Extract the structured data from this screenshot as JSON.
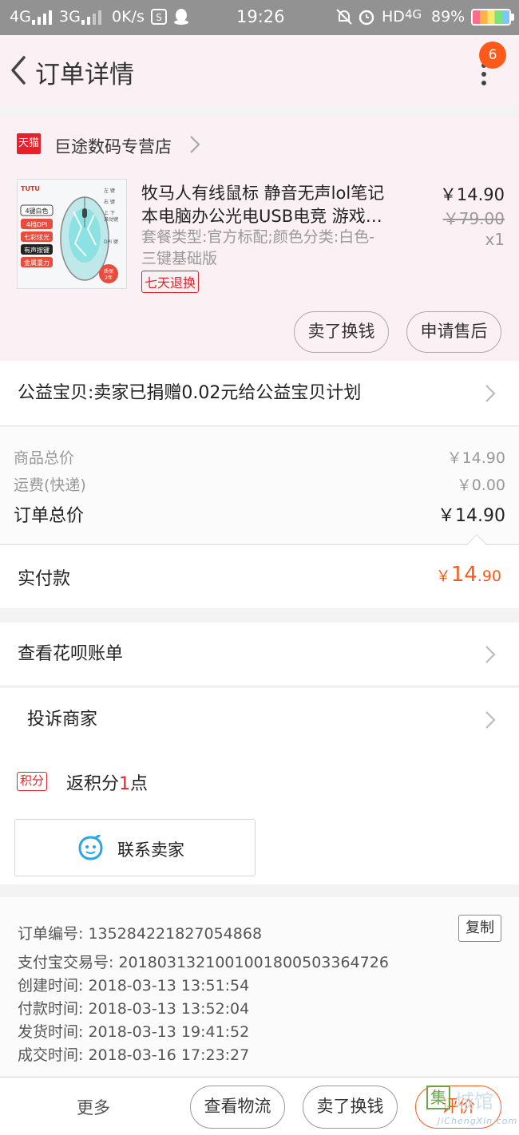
{
  "status_bar": {
    "network_1": "4G",
    "network_2": "3G",
    "speed": "0K/s",
    "time": "19:26",
    "hd_label": "HD",
    "hd_network": "4G",
    "battery": "89%"
  },
  "header": {
    "title": "订单详情",
    "notification_count": "6"
  },
  "shop": {
    "platform_badge": "天猫",
    "name": "巨途数码专营店"
  },
  "product": {
    "title": "牧马人有线鼠标 静音无声lol笔记本电脑办公光电USB电竞 游戏…",
    "spec": "套餐类型:官方标配;颜色分类:白色-三键基础版",
    "return_tag": "七天退换",
    "price": "￥14.90",
    "original_price": "￥79.00",
    "quantity": "x1",
    "image_text": {
      "brand": "TUTU",
      "feature_1": "4键白色",
      "feature_2": "4档DPI",
      "feature_3": "七彩炫光",
      "feature_4": "有声按键",
      "feature_5": "金属重力",
      "warranty_1": "质保",
      "warranty_2": "2年",
      "key_left": "左 键",
      "key_right": "右 键",
      "key_scroll_1": "上 下",
      "key_scroll_2": "滚动键",
      "key_dpi": "DPI 键"
    }
  },
  "actions": {
    "resell": "卖了换钱",
    "after_sales": "申请售后"
  },
  "charity": {
    "text": "公益宝贝:卖家已捐赠0.02元给公益宝贝计划"
  },
  "summary": {
    "goods_label": "商品总价",
    "goods_value": "￥14.90",
    "shipping_label": "运费(快递)",
    "shipping_value": "￥0.00",
    "total_label": "订单总价",
    "total_value": "￥14.90"
  },
  "payment": {
    "label": "实付款",
    "currency": "￥",
    "amount_int": "14",
    "amount_dec": ".90"
  },
  "menu": {
    "huabei": "查看花呗账单",
    "complain": "投诉商家",
    "points_tag": "积分",
    "points_prefix": "返积分",
    "points_num": "1",
    "points_suffix": "点"
  },
  "contact": {
    "label": "联系卖家"
  },
  "order_info": {
    "order_no": "订单编号: 135284221827054868",
    "copy_label": "复制",
    "alipay_no": "支付宝交易号: 2018031321001001800503364726",
    "created": "创建时间: 2018-03-13 13:51:54",
    "paid": "付款时间: 2018-03-13 13:52:04",
    "shipped": "发货时间: 2018-03-13 19:41:52",
    "completed": "成交时间: 2018-03-16 17:23:27"
  },
  "bottom_bar": {
    "more": "更多",
    "logistics": "查看物流",
    "resell": "卖了换钱",
    "review": "评价"
  },
  "watermark": {
    "box_char": "集",
    "text": "城馆",
    "url": "JiChengXin.com"
  },
  "colors": {
    "accent": "#ff5a1a",
    "tmall_red": "#e4222a",
    "status_bar": "#929292",
    "header_bg": "#fbf1f4"
  }
}
